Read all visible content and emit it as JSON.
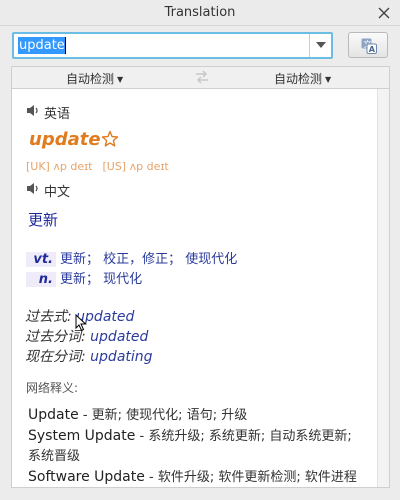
{
  "window": {
    "title": "Translation"
  },
  "search": {
    "query": "update"
  },
  "lang_bar": {
    "source": "自动检测",
    "target": "自动检测"
  },
  "english_section": {
    "label": "英语"
  },
  "headword": "update",
  "phonetics": {
    "uk": "[UK]  ʌp deɪt",
    "us": "[US]  ʌp deɪt"
  },
  "chinese_section": {
    "label": "中文"
  },
  "translation": "更新",
  "definitions": [
    {
      "pos": "vt.",
      "meanings": "更新；  校正，修正；  使现代化"
    },
    {
      "pos": "n.",
      "meanings": "更新；  现代化"
    }
  ],
  "inflections": [
    {
      "label": "过去式: ",
      "value": "updated"
    },
    {
      "label": "过去分词: ",
      "value": "updated"
    },
    {
      "label": "现在分词: ",
      "value": "updating"
    }
  ],
  "web": {
    "heading": "网络释义:",
    "entries": [
      {
        "term": "Update",
        "sep": " - ",
        "defs": "更新; 使现代化; 语句; 升级"
      },
      {
        "term": "System Update",
        "sep": " - ",
        "defs": "系统升级; 系统更新; 自动系统更新; 系统晋级"
      },
      {
        "term": "Software Update",
        "sep": " - ",
        "defs": "软件升级; 软件更新检测; 软件进程"
      }
    ]
  },
  "colors": {
    "accent": "#6bbde3",
    "headword": "#e07b1f",
    "link": "#2b3b9c"
  }
}
